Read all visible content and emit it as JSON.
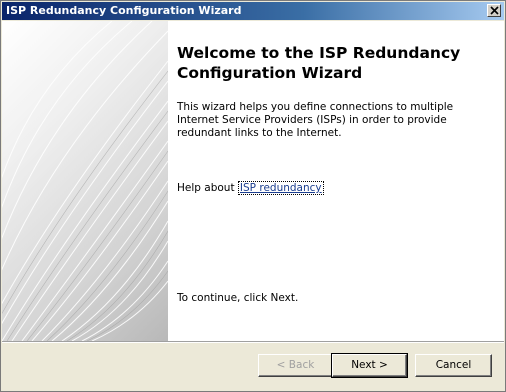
{
  "window": {
    "title": "ISP Redundancy Configuration Wizard"
  },
  "wizard": {
    "heading": "Welcome to the ISP Redundancy Configuration Wizard",
    "description": "This wizard helps you define connections to multiple Internet Service Providers (ISPs) in order to provide redundant links to the Internet.",
    "help_prefix": "Help about ",
    "help_link": "ISP redundancy",
    "continue_text": "To continue, click Next."
  },
  "buttons": {
    "back": "< Back",
    "next": "Next >",
    "cancel": "Cancel"
  },
  "icons": {
    "close": "close-icon"
  }
}
